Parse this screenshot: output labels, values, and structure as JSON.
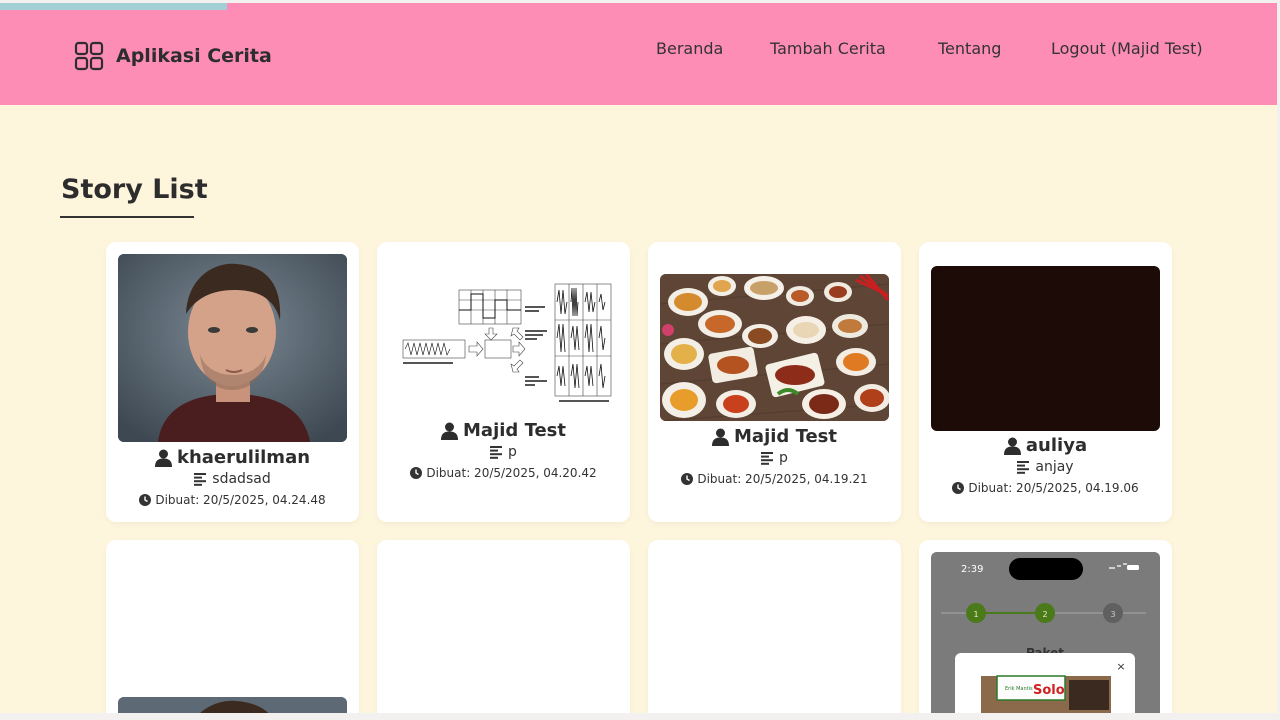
{
  "app": {
    "title": "Aplikasi Cerita",
    "icon": "grid-icon"
  },
  "nav": {
    "items": [
      {
        "label": "Beranda"
      },
      {
        "label": "Tambah Cerita"
      },
      {
        "label": "Tentang"
      },
      {
        "label": "Logout (Majid Test)"
      }
    ]
  },
  "colors": {
    "header": "#fd8db5",
    "background": "#fdf5dc",
    "progress": "#a3cfd7",
    "card": "#ffffff"
  },
  "page": {
    "title": "Story List"
  },
  "stories": [
    {
      "author": "khaerulilman",
      "description": "sdadsad",
      "created": "Dibuat: 20/5/2025, 04.24.48",
      "image": "portrait-photo"
    },
    {
      "author": "Majid Test",
      "description": "p",
      "created": "Dibuat: 20/5/2025, 04.20.42",
      "image": "modulation-diagram"
    },
    {
      "author": "Majid Test",
      "description": "p",
      "created": "Dibuat: 20/5/2025, 04.19.21",
      "image": "food-table-photo"
    },
    {
      "author": "auliya",
      "description": "anjay",
      "created": "Dibuat: 20/5/2025, 04.19.06",
      "image": "dark-photo"
    }
  ],
  "second_row": {
    "phone_time": "2:39",
    "steps": [
      "1",
      "2",
      "3"
    ],
    "heading": "Paket",
    "close": "×",
    "sign_small": "Erik Mantis",
    "sign_big": "Solo"
  }
}
